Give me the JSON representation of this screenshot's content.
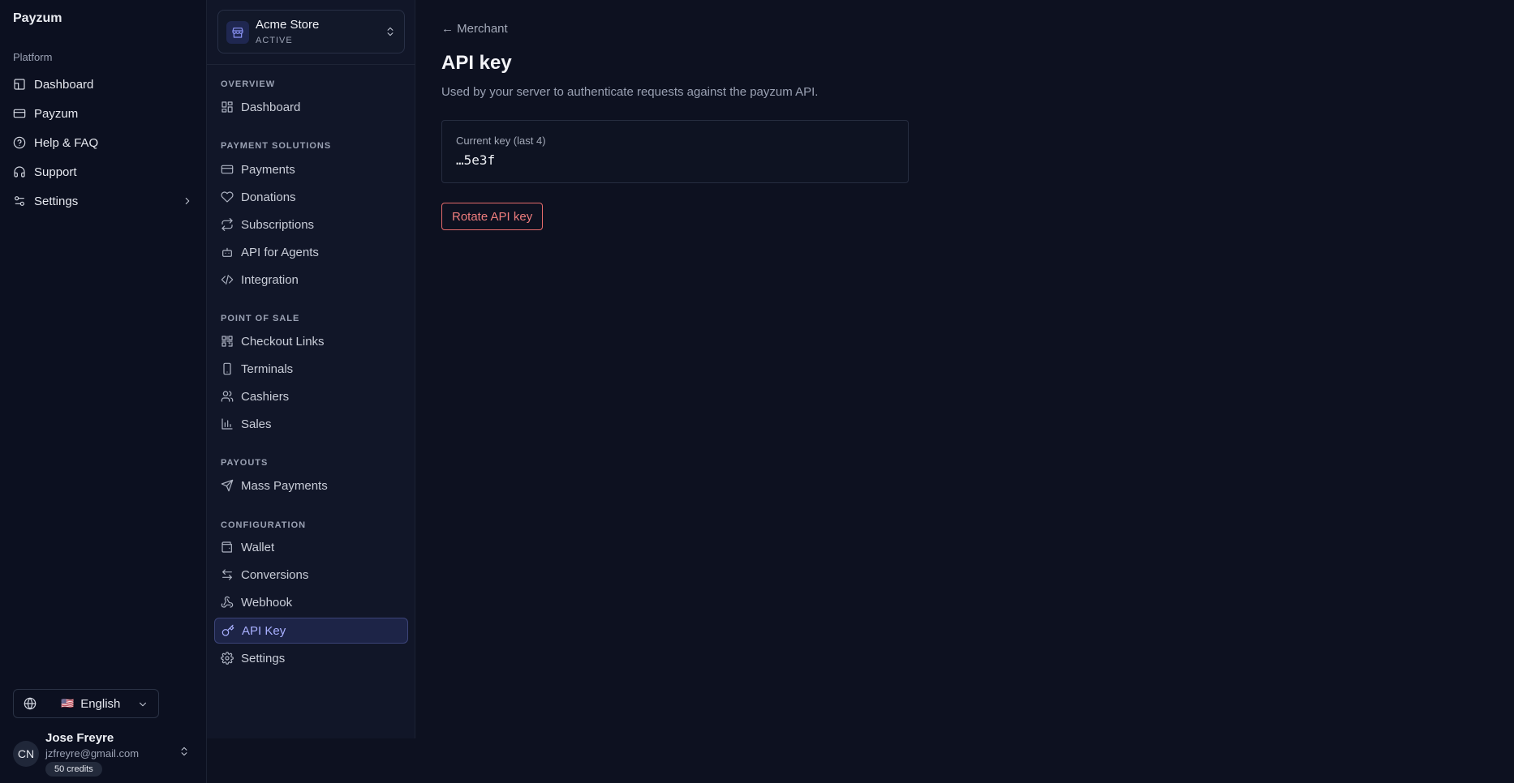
{
  "app": {
    "brand": "Payzum"
  },
  "primary_nav": {
    "section_label": "Platform",
    "items": [
      {
        "label": "Dashboard",
        "icon": "dashboard-icon"
      },
      {
        "label": "Payzum",
        "icon": "card-icon"
      },
      {
        "label": "Help & FAQ",
        "icon": "help-icon"
      },
      {
        "label": "Support",
        "icon": "headset-icon"
      },
      {
        "label": "Settings",
        "icon": "sliders-icon"
      }
    ]
  },
  "language": {
    "flag": "🇺🇸",
    "label": "English"
  },
  "user": {
    "initials": "CN",
    "name": "Jose Freyre",
    "email": "jzfreyre@gmail.com",
    "credits": "50 credits"
  },
  "store": {
    "name": "Acme Store",
    "status": "ACTIVE"
  },
  "secondary_nav": {
    "sections": [
      {
        "label": "OVERVIEW",
        "items": [
          "Dashboard"
        ]
      },
      {
        "label": "PAYMENT SOLUTIONS",
        "items": [
          "Payments",
          "Donations",
          "Subscriptions",
          "API for Agents",
          "Integration"
        ]
      },
      {
        "label": "POINT OF SALE",
        "items": [
          "Checkout Links",
          "Terminals",
          "Cashiers",
          "Sales"
        ]
      },
      {
        "label": "PAYOUTS",
        "items": [
          "Mass Payments"
        ]
      },
      {
        "label": "CONFIGURATION",
        "items": [
          "Wallet",
          "Conversions",
          "Webhook",
          "API Key",
          "Settings"
        ]
      }
    ],
    "active_item": "API Key"
  },
  "main": {
    "back_link": "← Merchant",
    "title": "API key",
    "subtitle": "Used by your server to authenticate requests against the payzum API.",
    "key_card": {
      "label": "Current key (last 4)",
      "value": "…5e3f"
    },
    "rotate_button": "Rotate API key"
  },
  "colors": {
    "accent": "#a9b0ff",
    "danger": "#ee7d7d",
    "background": "#0d1120"
  }
}
